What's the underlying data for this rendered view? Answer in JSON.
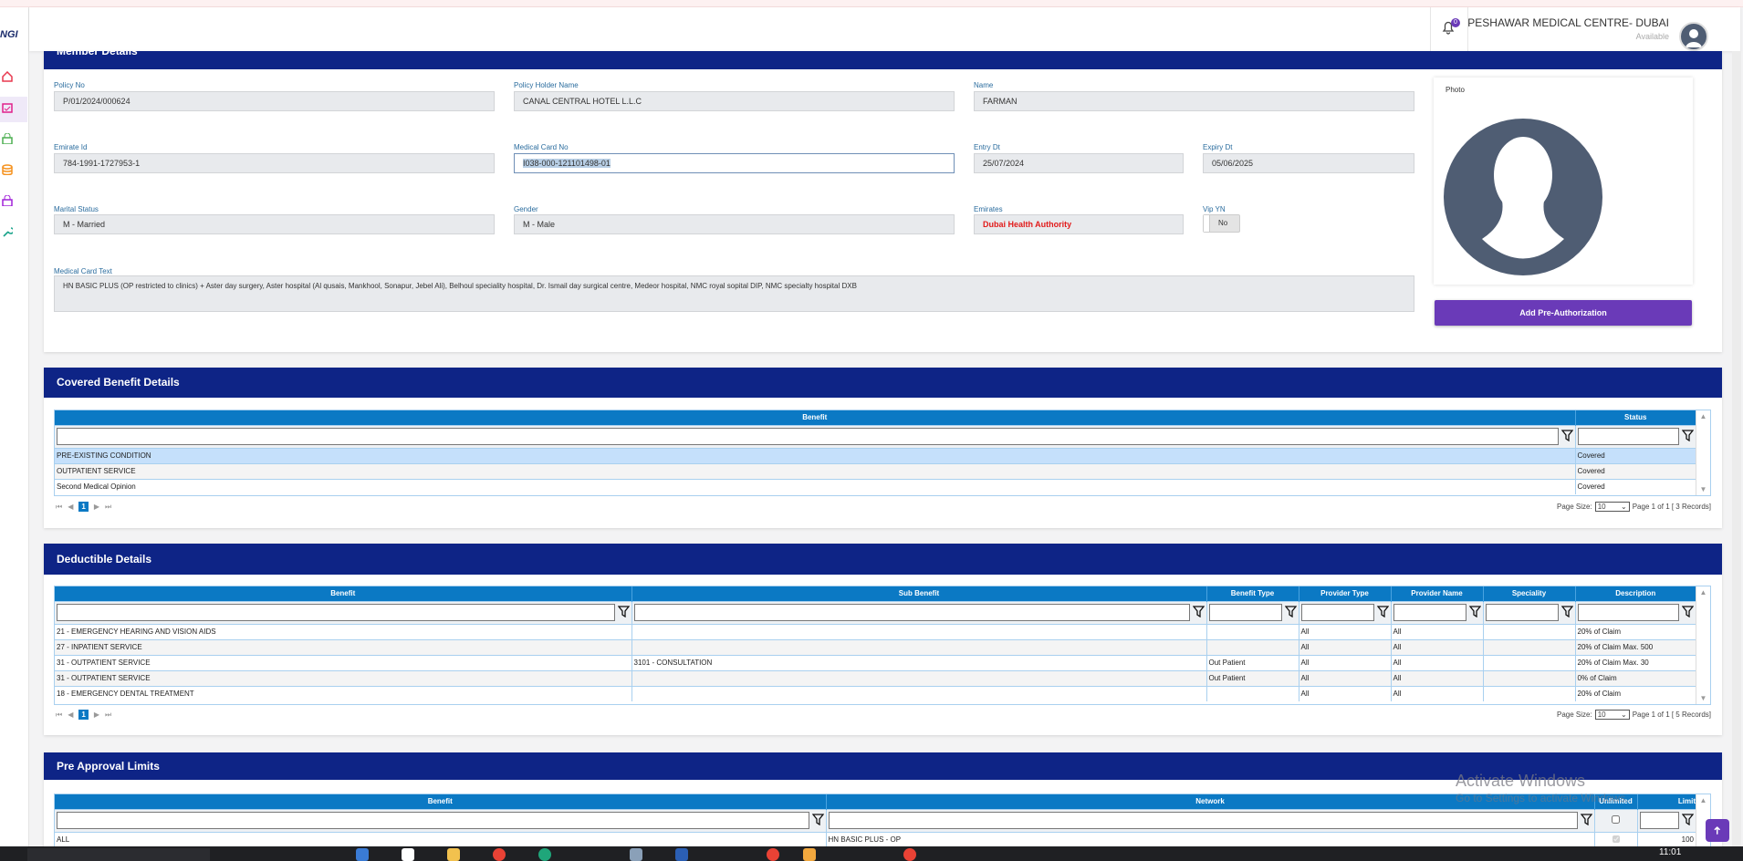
{
  "header": {
    "provider": "PESHAWAR MEDICAL CENTRE- DUBAI",
    "status": "Available",
    "notifications": "0",
    "logo": "NGI"
  },
  "sidebar": {
    "icons": [
      "home-icon",
      "calendar-check-icon",
      "lock-icon",
      "database-icon",
      "lock-icon",
      "wrench-icon"
    ]
  },
  "member": {
    "title": "Member Details",
    "policy_no": {
      "label": "Policy No",
      "value": "P/01/2024/000624"
    },
    "policy_holder": {
      "label": "Policy Holder Name",
      "value": "CANAL CENTRAL HOTEL L.L.C"
    },
    "name": {
      "label": "Name",
      "value": "FARMAN"
    },
    "emirate_id": {
      "label": "Emirate Id",
      "value": "784-1991-1727953-1"
    },
    "card_no": {
      "label": "Medical Card No",
      "value": "I038-000-121101498-01"
    },
    "entry_dt": {
      "label": "Entry Dt",
      "value": "25/07/2024"
    },
    "expiry_dt": {
      "label": "Expiry Dt",
      "value": "05/06/2025"
    },
    "marital": {
      "label": "Marital Status",
      "value": "M - Married"
    },
    "gender": {
      "label": "Gender",
      "value": "M - Male"
    },
    "emirates": {
      "label": "Emirates",
      "value": "Dubai Health Authority"
    },
    "vip": {
      "label": "Vip YN",
      "value": "No"
    },
    "card_text": {
      "label": "Medical Card Text",
      "value": "HN BASIC PLUS (OP restricted to clinics) + Aster day surgery, Aster hospital (Al qusais, Mankhool, Sonapur, Jebel Ali), Belhoul speciality hospital, Dr. Ismail day surgical centre, Medeor hospital, NMC royal sopital DIP,  NMC specialty hospital DXB"
    },
    "photo_label": "Photo",
    "add_button": "Add Pre-Authorization"
  },
  "covered": {
    "title": "Covered Benefit Details",
    "columns": [
      "Benefit",
      "Status"
    ],
    "rows": [
      [
        "PRE-EXISTING CONDITION",
        "Covered"
      ],
      [
        "OUTPATIENT SERVICE",
        "Covered"
      ],
      [
        "Second Medical Opinion",
        "Covered"
      ]
    ],
    "page": "1",
    "page_size_label": "Page Size:",
    "page_size": "10",
    "page_info": "Page 1 of 1 [ 3 Records]"
  },
  "deductible": {
    "title": "Deductible Details",
    "columns": [
      "Benefit",
      "Sub Benefit",
      "Benefit Type",
      "Provider Type",
      "Provider Name",
      "Speciality",
      "Description"
    ],
    "rows": [
      [
        "21 - EMERGENCY HEARING AND VISION AIDS",
        "",
        "",
        "All",
        "All",
        "",
        "20% of Claim"
      ],
      [
        "27 - INPATIENT SERVICE",
        "",
        "",
        "All",
        "All",
        "",
        "20% of Claim Max. 500"
      ],
      [
        "31 - OUTPATIENT SERVICE",
        "3101 - CONSULTATION",
        "Out Patient",
        "All",
        "All",
        "",
        "20% of Claim Max. 30"
      ],
      [
        "31 - OUTPATIENT SERVICE",
        "",
        "Out Patient",
        "All",
        "All",
        "",
        "0% of Claim"
      ],
      [
        "18 - EMERGENCY DENTAL TREATMENT",
        "",
        "",
        "All",
        "All",
        "",
        "20% of Claim"
      ]
    ],
    "page": "1",
    "page_size_label": "Page Size:",
    "page_size": "10",
    "page_info": "Page 1 of 1 [ 5 Records]"
  },
  "preapproval": {
    "title": "Pre Approval Limits",
    "columns": [
      "Benefit",
      "Network",
      "Unlimited",
      "Limit"
    ],
    "rows": [
      [
        "ALL",
        "HN BASIC PLUS - OP",
        "",
        "100"
      ]
    ]
  },
  "watermark": {
    "line1": "Activate Windows",
    "line2": "Go to Settings to activate Windows."
  },
  "taskbar": {
    "time": "11:01"
  }
}
